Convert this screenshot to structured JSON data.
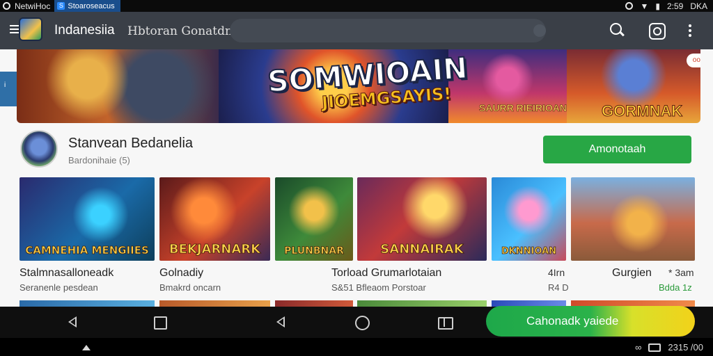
{
  "status_bar": {
    "left_text": "NetwiHoc",
    "tab_label": "Stoaroseacus",
    "time": "2:59",
    "right_suffix": "DKA"
  },
  "app_bar": {
    "title": "Indanesiia",
    "subtitle": "Hbtoran Gonatdna"
  },
  "side_tab": {
    "label": "i"
  },
  "banner": {
    "title": "SOMWIOAIN",
    "subtitle": "JIOEMGSAYIS!",
    "card3_text": "SAURR RIEIRIOAN",
    "card4_text": "GORMNAK",
    "badge": "oor"
  },
  "app_info": {
    "name": "Stanvean Bedanelia",
    "meta": "Bardonihaie (5)",
    "install_label": "Amonotaah"
  },
  "games": [
    {
      "thumb_text": "CAMNEHIA MENGIIES",
      "title": "Stalmnasalloneadk",
      "subtitle": "Seranenle pesdean"
    },
    {
      "thumb_text": "BEKJARNARK",
      "title": "Golnadiy",
      "subtitle": "Bmakrd oncarn"
    },
    {
      "thumb_text": "PLUNBNAR",
      "title": "",
      "subtitle": ""
    },
    {
      "thumb_text": "SANNAIRAK",
      "title": "Torload Grumarlotaian",
      "subtitle": "S&51 Bfleaom Porstoar"
    },
    {
      "thumb_text": "DKNNIOAN",
      "title": "",
      "subtitle": ""
    },
    {
      "thumb_text": "",
      "title": "Gurgien",
      "subtitle": ""
    }
  ],
  "game_extras": {
    "g4_right_top": "4Irn",
    "g4_right_bottom": "R4 D",
    "g6_right_top": "* 3am",
    "g6_right_bottom": "Bdda 1z"
  },
  "toast": {
    "label": "Cahonadk yaiede"
  },
  "bottom_strip": {
    "time": "2315 /00"
  },
  "colors": {
    "app_bar": "#3a3f47",
    "install_button": "#28a745",
    "content_bg": "#f7f7f7"
  }
}
